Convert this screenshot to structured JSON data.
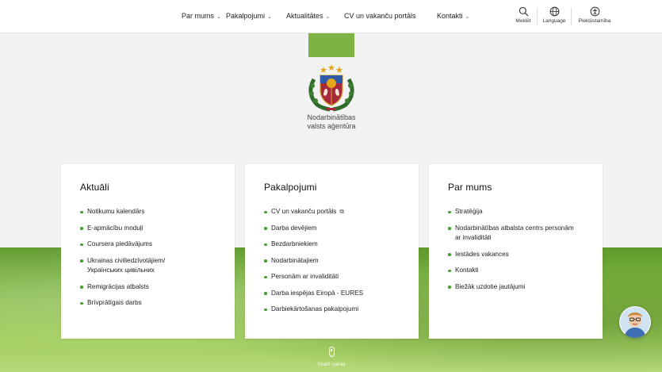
{
  "nav": {
    "items": [
      {
        "label": "Par mums",
        "dropdown": true
      },
      {
        "label": "Pakalpojumi",
        "dropdown": true
      },
      {
        "label": "Aktualitātes",
        "dropdown": true
      },
      {
        "label": "CV un vakanču portāls",
        "dropdown": false
      },
      {
        "label": "Kontakti",
        "dropdown": true
      }
    ],
    "chevron": "⌄"
  },
  "tools": {
    "search": {
      "label": "Meklēt",
      "icon": "search-icon"
    },
    "language": {
      "label": "Language",
      "icon": "globe-icon"
    },
    "accessibility": {
      "label": "Piekļūstamība",
      "icon": "accessibility-icon"
    }
  },
  "logo": {
    "line1": "Nodarbinātības",
    "line2": "valsts aģentūra",
    "icon": "latvia-coat-of-arms"
  },
  "cards": [
    {
      "title": "Aktuāli",
      "items": [
        {
          "label": "Notikumu kalendārs"
        },
        {
          "label": "E-apmācību moduļi"
        },
        {
          "label": "Coursera piedāvājums"
        },
        {
          "label": "Ukrainas civiliedzīvotājiem/ Українських цивільних"
        },
        {
          "label": "Remigrācijas atbalsts"
        },
        {
          "label": "Brīvprātīgais darbs"
        }
      ]
    },
    {
      "title": "Pakalpojumi",
      "items": [
        {
          "label": "CV un vakanču portāls",
          "external": true
        },
        {
          "label": "Darba devējiem"
        },
        {
          "label": "Bezdarbniekiem"
        },
        {
          "label": "Nodarbinātajiem"
        },
        {
          "label": "Personām ar invaliditāti"
        },
        {
          "label": "Darba iespējas Eiropā - EURES"
        },
        {
          "label": "Darbiekārtošanas pakalpojumi"
        }
      ]
    },
    {
      "title": "Par mums",
      "items": [
        {
          "label": "Stratēģija"
        },
        {
          "label": "Nodarbinātības atbalsta centrs personām ar invaliditāti"
        },
        {
          "label": "Iestādes vakances"
        },
        {
          "label": "Kontakti"
        },
        {
          "label": "Biežāk uzdotie jautājumi"
        }
      ]
    }
  ],
  "external_icon": "external-link-icon",
  "scroll_hint": {
    "label": "Skatīt vairāk",
    "icon": "mouse-scroll-icon"
  },
  "chatbot": {
    "icon": "chatbot-avatar-icon"
  },
  "colors": {
    "accent_green": "#43a02b",
    "brand_green": "#7cb342",
    "card_bg": "#ffffff"
  }
}
